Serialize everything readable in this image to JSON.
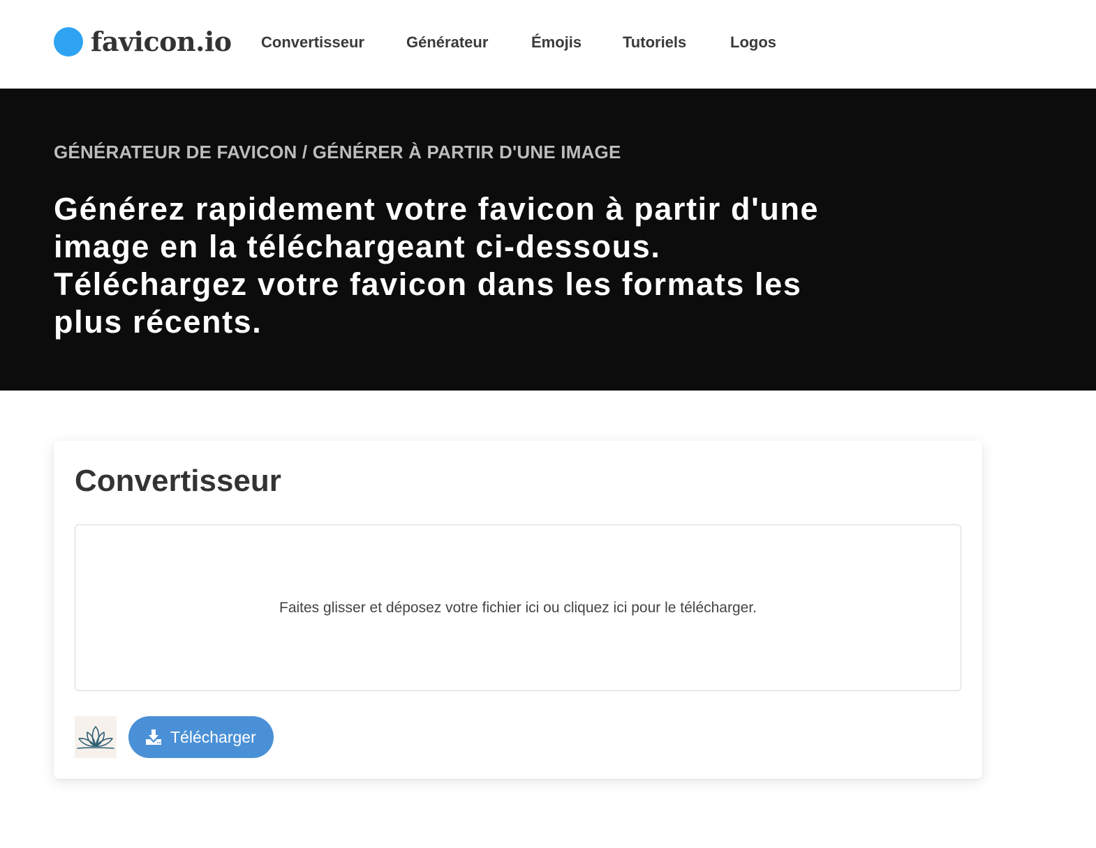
{
  "header": {
    "logo_text": "favicon.io",
    "nav": [
      {
        "label": "Convertisseur"
      },
      {
        "label": "Générateur"
      },
      {
        "label": "Émojis"
      },
      {
        "label": "Tutoriels"
      },
      {
        "label": "Logos"
      }
    ]
  },
  "hero": {
    "breadcrumb": "GÉNÉRATEUR DE FAVICON / GÉNÉRER À PARTIR D'UNE IMAGE",
    "heading": "Générez rapidement votre favicon à partir d'une image en la téléchargeant ci-dessous. Téléchargez votre favicon dans les formats les plus récents."
  },
  "converter": {
    "title": "Convertisseur",
    "dropzone_text": "Faites glisser et déposez votre fichier ici ou cliquez ici pour le télécharger.",
    "upload_button_label": "Télécharger",
    "upload_icon": "download-icon",
    "thumbnail_icon": "lotus-icon"
  },
  "colors": {
    "brand_dot": "#2ea3f2",
    "hero_background": "#0c0c0c",
    "button": "#4a90d6",
    "thumbnail_background": "#f6f1ec",
    "lotus_stroke": "#2f5f73"
  }
}
